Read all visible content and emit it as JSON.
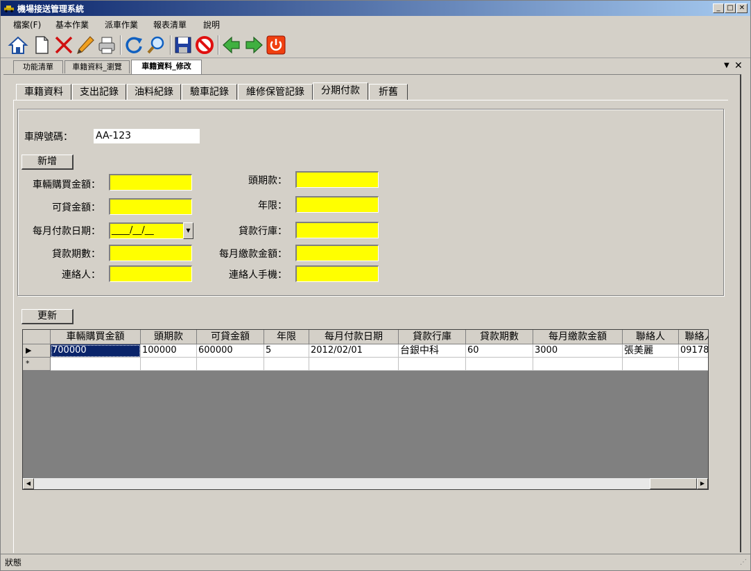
{
  "window": {
    "title": "機場接送管理系統"
  },
  "menu": [
    "檔案(F)",
    "基本作業",
    "派車作業",
    "報表清單",
    "說明"
  ],
  "toolbar": [
    "home-icon",
    "new-doc-icon",
    "delete-icon",
    "edit-icon",
    "print-icon",
    "refresh-icon",
    "search-icon",
    "save-icon",
    "stop-icon",
    "prev-icon",
    "next-icon",
    "power-icon"
  ],
  "doc_tabs": [
    "功能清單",
    "車籍資料_瀏覽",
    "車籍資料_修改"
  ],
  "doc_tab_active": 2,
  "inner_tabs": [
    "車籍資料",
    "支出記錄",
    "油料紀錄",
    "驗車記錄",
    "維修保管記錄",
    "分期付款",
    "折舊"
  ],
  "inner_tab_active": 5,
  "plate": {
    "label": "車牌號碼：",
    "value": "AA-123"
  },
  "buttons": {
    "add": "新增",
    "update": "更新"
  },
  "form": {
    "purchase_amount": "車輛購買金額：",
    "down_payment": "頭期款：",
    "loanable_amount": "可貸金額：",
    "years": "年限：",
    "monthly_pay_date": "每月付款日期：",
    "monthly_pay_date_value": "____/__/__",
    "loan_bank": "貸款行庫：",
    "loan_periods": "貸款期數：",
    "monthly_amount": "每月繳款金額：",
    "contact": "連絡人：",
    "contact_mobile": "連絡人手機："
  },
  "grid": {
    "columns": [
      "車輛購買金額",
      "頭期款",
      "可貸金額",
      "年限",
      "每月付款日期",
      "貸款行庫",
      "貸款期數",
      "每月繳款金額",
      "聯絡人",
      "聯絡人"
    ],
    "rows": [
      [
        "700000",
        "100000",
        "600000",
        "5",
        "2012/02/01",
        "台銀中科",
        "60",
        "3000",
        "張美麗",
        "09178"
      ]
    ],
    "new_row_marker": "*",
    "current_row_marker": "▶"
  },
  "status": {
    "text": "狀態"
  },
  "colors": {
    "input_yellow": "#ffff00",
    "title_blue": "#0a246a",
    "selected_cell": "#0a246a"
  }
}
